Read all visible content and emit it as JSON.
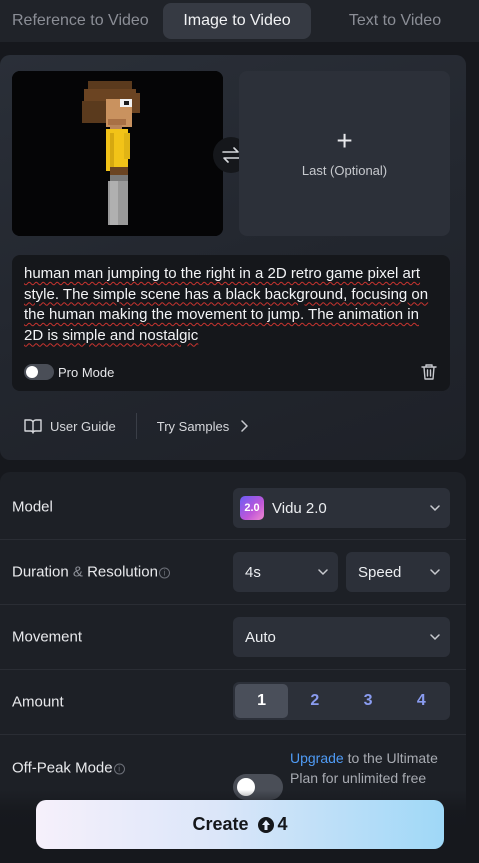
{
  "tabs": [
    {
      "label": "Reference to Video"
    },
    {
      "label": "Image to Video"
    },
    {
      "label": "Text to Video"
    }
  ],
  "upload": {
    "last_label": "Last (Optional)"
  },
  "prompt": {
    "text": "human man jumping to the right in a 2D retro game pixel art style. The simple scene has a black background, focusing on the human making the movement to jump. The animation in 2D is simple and nostalgic",
    "pro_mode_label": "Pro Mode"
  },
  "links": {
    "user_guide": "User Guide",
    "try_samples": "Try Samples"
  },
  "settings": {
    "model_label": "Model",
    "model_value": "Vidu 2.0",
    "model_logo_text": "2.0",
    "duration_label": "Duration",
    "duration_amp": "&",
    "resolution_label": "Resolution",
    "duration_value": "4s",
    "speed_value": "Speed",
    "movement_label": "Movement",
    "movement_value": "Auto",
    "amount_label": "Amount",
    "amount_options": [
      "1",
      "2",
      "3",
      "4"
    ],
    "amount_selected": "1",
    "offpeak_label": "Off-Peak Mode",
    "upgrade_link": "Upgrade",
    "upgrade_text": "to the Ultimate Plan for unlimited free"
  },
  "create": {
    "label": "Create",
    "credits": "4"
  },
  "colors": {
    "accent_link": "#4f9bf5",
    "amount_text": "#8a9cf0",
    "background": "#16181d"
  }
}
